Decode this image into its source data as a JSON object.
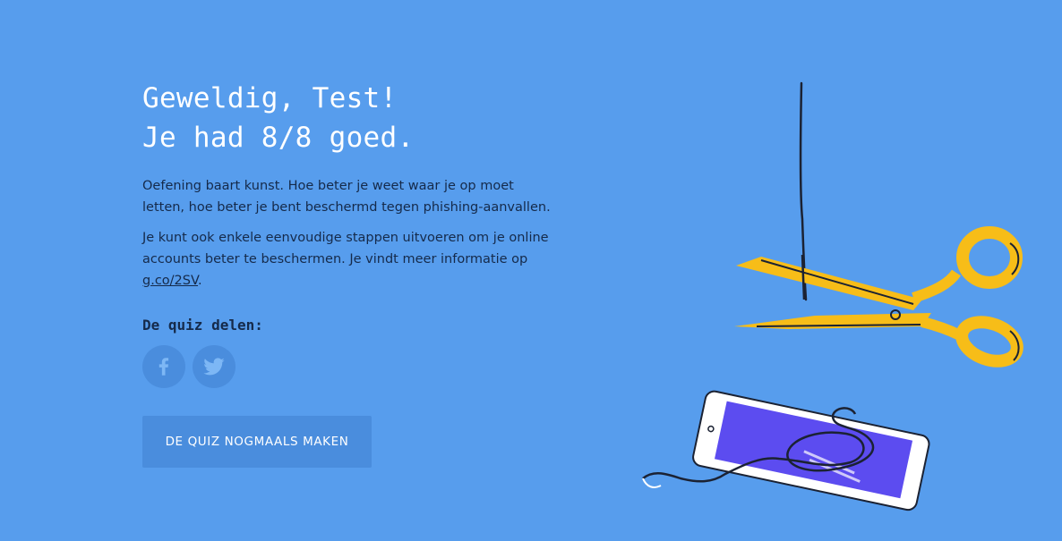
{
  "result": {
    "headline_line1": "Geweldig, Test!",
    "headline_line2": "Je had 8/8 goed.",
    "paragraph1": "Oefening baart kunst. Hoe beter je weet waar je op moet letten, hoe beter je bent beschermd tegen phishing-aanvallen.",
    "paragraph2_text": "Je kunt ook enkele eenvoudige stappen uitvoeren om je online accounts beter te beschermen. Je vindt meer informatie op ",
    "paragraph2_link": "g.co/2SV",
    "paragraph2_end": "."
  },
  "share": {
    "heading": "De quiz delen:",
    "icons": [
      "facebook-icon",
      "twitter-icon"
    ]
  },
  "actions": {
    "retry_label": "DE QUIZ NOGMAALS MAKEN"
  },
  "colors": {
    "background": "#579ded",
    "button": "#4a8ddd",
    "text_dark": "#152a4a",
    "scissors": "#f7bd18",
    "phone_screen": "#5c4cf0"
  }
}
